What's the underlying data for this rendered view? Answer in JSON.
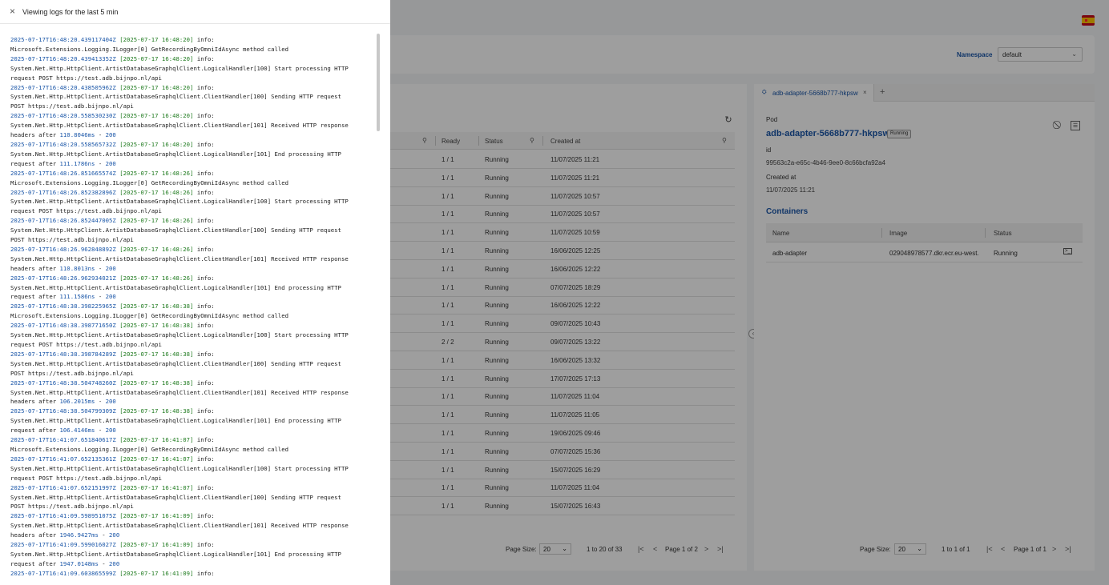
{
  "drawer": {
    "title": "Viewing logs for the last 5 min",
    "lines": [
      {
        "ts": "2025-07-17T16:48:20.439117404Z",
        "br": "[2025-07-17 16:48:20]",
        "rest": " info:"
      },
      {
        "text": "Microsoft.Extensions.Logging.ILogger[0] GetRecordingByOmniIdAsync method called"
      },
      {
        "ts": "2025-07-17T16:48:20.439413352Z",
        "br": "[2025-07-17 16:48:20]",
        "rest": " info:"
      },
      {
        "text": "System.Net.Http.HttpClient.ArtistDatabaseGraphqlClient.LogicalHandler[100] Start processing HTTP"
      },
      {
        "text": "request POST https://test.adb.bijnpo.nl/api"
      },
      {
        "ts": "2025-07-17T16:48:20.438505962Z",
        "br": "[2025-07-17 16:48:20]",
        "rest": " info:"
      },
      {
        "text": "System.Net.Http.HttpClient.ArtistDatabaseGraphqlClient.ClientHandler[100] Sending HTTP request"
      },
      {
        "text": "POST https://test.adb.bijnpo.nl/api"
      },
      {
        "ts": "2025-07-17T16:48:20.558530230Z",
        "br": "[2025-07-17 16:48:20]",
        "rest": " info:"
      },
      {
        "text": "System.Net.Http.HttpClient.ArtistDatabaseGraphqlClient.ClientHandler[101] Received HTTP response"
      },
      {
        "pre": "headers after ",
        "num": "110.8046ms",
        "post": " - ",
        "num2": "200"
      },
      {
        "ts": "2025-07-17T16:48:20.558565732Z",
        "br": "[2025-07-17 16:48:20]",
        "rest": " info:"
      },
      {
        "text": "System.Net.Http.HttpClient.ArtistDatabaseGraphqlClient.LogicalHandler[101] End processing HTTP"
      },
      {
        "pre": "request after ",
        "num": "111.1786ns",
        "post": " - ",
        "num2": "200"
      },
      {
        "ts": "2025-07-17T16:48:26.851665574Z",
        "br": "[2025-07-17 16:48:26]",
        "rest": " info:"
      },
      {
        "text": "Microsoft.Extensions.Logging.ILogger[0] GetRecordingByOmniIdAsync method called"
      },
      {
        "ts": "2025-07-17T16:48:26.852382896Z",
        "br": "[2025-07-17 16:48:26]",
        "rest": " info:"
      },
      {
        "text": "System.Net.Http.HttpClient.ArtistDatabaseGraphqlClient.LogicalHandler[100] Start processing HTTP"
      },
      {
        "text": "request POST https://test.adb.bijnpo.nl/api"
      },
      {
        "ts": "2025-07-17T16:48:26.852447005Z",
        "br": "[2025-07-17 16:48:26]",
        "rest": " info:"
      },
      {
        "text": "System.Net.Http.HttpClient.ArtistDatabaseGraphqlClient.ClientHandler[100] Sending HTTP request"
      },
      {
        "text": "POST https://test.adb.bijnpo.nl/api"
      },
      {
        "ts": "2025-07-17T16:48:26.962848892Z",
        "br": "[2025-07-17 16:48:26]",
        "rest": " info:"
      },
      {
        "text": "System.Net.Http.HttpClient.ArtistDatabaseGraphqlClient.ClientHandler[101] Received HTTP response"
      },
      {
        "pre": "headers after ",
        "num": "110.8013ns",
        "post": " - ",
        "num2": "200"
      },
      {
        "ts": "2025-07-17T16:48:26.962934021Z",
        "br": "[2025-07-17 16:48:26]",
        "rest": " info:"
      },
      {
        "text": "System.Net.Http.HttpClient.ArtistDatabaseGraphqlClient.LogicalHandler[101] End processing HTTP"
      },
      {
        "pre": "request after ",
        "num": "111.1586ns",
        "post": " - ",
        "num2": "200"
      },
      {
        "ts": "2025-07-17T16:48:38.398225965Z",
        "br": "[2025-07-17 16:48:38]",
        "rest": " info:"
      },
      {
        "text": "Microsoft.Extensions.Logging.ILogger[0] GetRecordingByOmniIdAsync method called"
      },
      {
        "ts": "2025-07-17T16:48:38.398771650Z",
        "br": "[2025-07-17 16:48:38]",
        "rest": " info:"
      },
      {
        "text": "System.Net.Http.HttpClient.ArtistDatabaseGraphqlClient.LogicalHandler[100] Start processing HTTP"
      },
      {
        "text": "request POST https://test.adb.bijnpo.nl/api"
      },
      {
        "ts": "2025-07-17T16:48:38.398784289Z",
        "br": "[2025-07-17 16:48:38]",
        "rest": " info:"
      },
      {
        "text": "System.Net.Http.HttpClient.ArtistDatabaseGraphqlClient.ClientHandler[100] Sending HTTP request"
      },
      {
        "text": "POST https://test.adb.bijnpo.nl/api"
      },
      {
        "ts": "2025-07-17T16:48:38.504748260Z",
        "br": "[2025-07-17 16:48:38]",
        "rest": " info:"
      },
      {
        "text": "System.Net.Http.HttpClient.ArtistDatabaseGraphqlClient.ClientHandler[101] Received HTTP response"
      },
      {
        "pre": "headers after ",
        "num": "106.2015ms",
        "post": " - ",
        "num2": "200"
      },
      {
        "ts": "2025-07-17T16:48:38.504799309Z",
        "br": "[2025-07-17 16:48:38]",
        "rest": " info:"
      },
      {
        "text": "System.Net.Http.HttpClient.ArtistDatabaseGraphqlClient.LogicalHandler[101] End processing HTTP"
      },
      {
        "pre": "request after ",
        "num": "106.4146ms",
        "post": " - ",
        "num2": "200"
      },
      {
        "ts": "2025-07-17T16:41:07.651840617Z",
        "br": "[2025-07-17 16:41:07]",
        "rest": " info:"
      },
      {
        "text": "Microsoft.Extensions.Logging.ILogger[0] GetRecordingByOmniIdAsync method called"
      },
      {
        "ts": "2025-07-17T16:41:07.652135361Z",
        "br": "[2025-07-17 16:41:07]",
        "rest": " info:"
      },
      {
        "text": "System.Net.Http.HttpClient.ArtistDatabaseGraphqlClient.LogicalHandler[100] Start processing HTTP"
      },
      {
        "text": "request POST https://test.adb.bijnpo.nl/api"
      },
      {
        "ts": "2025-07-17T16:41:07.652151997Z",
        "br": "[2025-07-17 16:41:07]",
        "rest": " info:"
      },
      {
        "text": "System.Net.Http.HttpClient.ArtistDatabaseGraphqlClient.ClientHandler[100] Sending HTTP request"
      },
      {
        "text": "POST https://test.adb.bijnpo.nl/api"
      },
      {
        "ts": "2025-07-17T16:41:09.598951075Z",
        "br": "[2025-07-17 16:41:09]",
        "rest": " info:"
      },
      {
        "text": "System.Net.Http.HttpClient.ArtistDatabaseGraphqlClient.ClientHandler[101] Received HTTP response"
      },
      {
        "pre": "headers after ",
        "num": "1946.9427ms",
        "post": " - ",
        "num2": "200"
      },
      {
        "ts": "2025-07-17T16:41:09.599016027Z",
        "br": "[2025-07-17 16:41:09]",
        "rest": " info:"
      },
      {
        "text": "System.Net.Http.HttpClient.ArtistDatabaseGraphqlClient.LogicalHandler[101] End processing HTTP"
      },
      {
        "pre": "request after ",
        "num": "1947.0148ms",
        "post": " - ",
        "num2": "200"
      },
      {
        "ts": "2025-07-17T16:41:09.603865599Z",
        "br": "[2025-07-17 16:41:09]",
        "rest": " info:"
      }
    ]
  },
  "namespace": {
    "label": "Namespace",
    "value": "default"
  },
  "table": {
    "headers": {
      "ready": "Ready",
      "status": "Status",
      "created": "Created at"
    },
    "rows": [
      {
        "ready": "1 / 1",
        "status": "Running",
        "created": "11/07/2025 11:21"
      },
      {
        "ready": "1 / 1",
        "status": "Running",
        "created": "11/07/2025 11:21"
      },
      {
        "ready": "1 / 1",
        "status": "Running",
        "created": "11/07/2025 10:57"
      },
      {
        "ready": "1 / 1",
        "status": "Running",
        "created": "11/07/2025 10:57"
      },
      {
        "ready": "1 / 1",
        "status": "Running",
        "created": "11/07/2025 10:59"
      },
      {
        "ready": "1 / 1",
        "status": "Running",
        "created": "16/06/2025 12:25"
      },
      {
        "ready": "1 / 1",
        "status": "Running",
        "created": "16/06/2025 12:22"
      },
      {
        "ready": "1 / 1",
        "status": "Running",
        "created": "07/07/2025 18:29"
      },
      {
        "ready": "1 / 1",
        "status": "Running",
        "created": "16/06/2025 12:22"
      },
      {
        "ready": "1 / 1",
        "status": "Running",
        "created": "09/07/2025 10:43"
      },
      {
        "ready": "2 / 2",
        "status": "Running",
        "created": "09/07/2025 13:22"
      },
      {
        "ready": "1 / 1",
        "status": "Running",
        "created": "16/06/2025 13:32"
      },
      {
        "ready": "1 / 1",
        "status": "Running",
        "created": "17/07/2025 17:13"
      },
      {
        "ready": "1 / 1",
        "status": "Running",
        "created": "11/07/2025 11:04"
      },
      {
        "ready": "1 / 1",
        "status": "Running",
        "created": "11/07/2025 11:05"
      },
      {
        "ready": "1 / 1",
        "status": "Running",
        "created": "19/06/2025 09:46"
      },
      {
        "ready": "1 / 1",
        "status": "Running",
        "created": "07/07/2025 15:36"
      },
      {
        "ready": "1 / 1",
        "status": "Running",
        "created": "15/07/2025 16:29"
      },
      {
        "ready": "1 / 1",
        "status": "Running",
        "created": "11/07/2025 11:04"
      },
      {
        "ready": "1 / 1",
        "status": "Running",
        "created": "15/07/2025 16:43"
      }
    ],
    "pager": {
      "size_label": "Page Size:",
      "size": "20",
      "range": "1 to 20 of 33",
      "page": "Page 1 of 2"
    }
  },
  "detail": {
    "tab_label": "adb-adapter-5668b777-hkpsw",
    "tab_add": "+",
    "pod_label": "Pod",
    "pod_name": "adb-adapter-5668b777-hkpsw",
    "pod_status": "Running",
    "id_label": "id",
    "id_value": "99563c2a-e65c-4b46-9ee0-8c66bcfa92a4",
    "created_label": "Created at",
    "created_value": "11/07/2025 11:21",
    "containers_title": "Containers",
    "containers": {
      "headers": {
        "name": "Name",
        "image": "Image",
        "status": "Status"
      },
      "rows": [
        {
          "name": "adb-adapter",
          "image": "029048978577.dkr.ecr.eu-west...",
          "status": "Running"
        }
      ]
    },
    "pager": {
      "size_label": "Page Size:",
      "size": "20",
      "range": "1 to 1 of 1",
      "page": "Page 1 of 1"
    }
  },
  "icons": {
    "close": "×",
    "refresh": "↻",
    "chevron": "⌄",
    "first": "|<",
    "prev": "<",
    "next": ">",
    "last": ">|",
    "tab_close": "×",
    "toggle": "‹",
    "block": "⃠",
    "doc": "☰",
    "terminal": ">_",
    "filter": "⚲"
  }
}
